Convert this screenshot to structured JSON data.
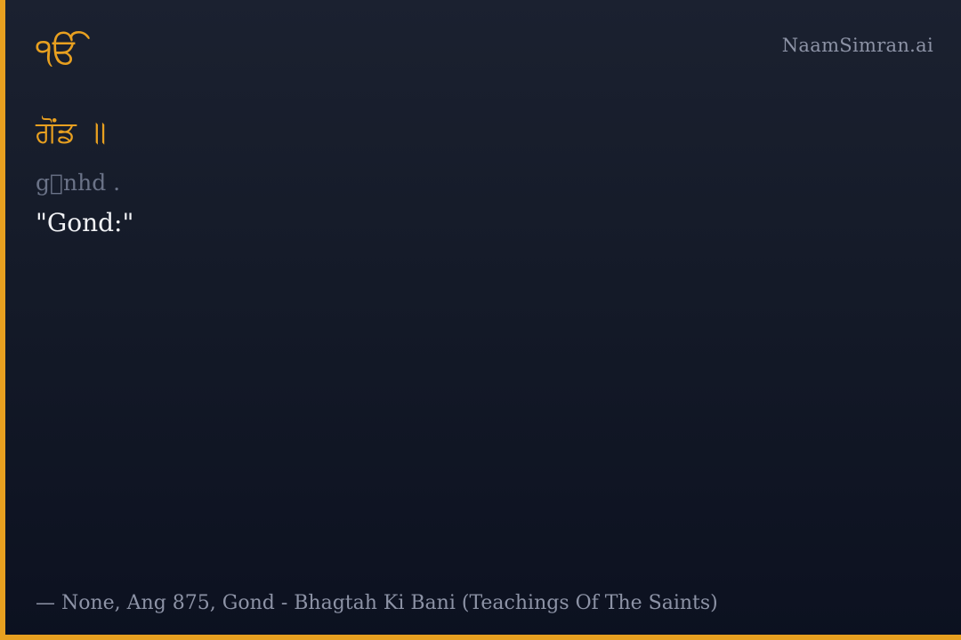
{
  "header": {
    "symbol": "ੴ",
    "brand": "NaamSimran.ai"
  },
  "verse": {
    "gurmukhi": "ਗੋਂਡ ॥",
    "transliteration": "g\u0000nhd .",
    "translation": "\"Gond:\""
  },
  "footer": {
    "source": "— None, Ang 875, Gond - Bhagtah Ki Bani (Teachings Of The Saints)"
  },
  "colors": {
    "accent": "#e8a020",
    "background_top": "#1b2130",
    "background_bottom": "#0c1120",
    "muted_text": "#8d93a6",
    "primary_text": "#f1f2f5"
  }
}
